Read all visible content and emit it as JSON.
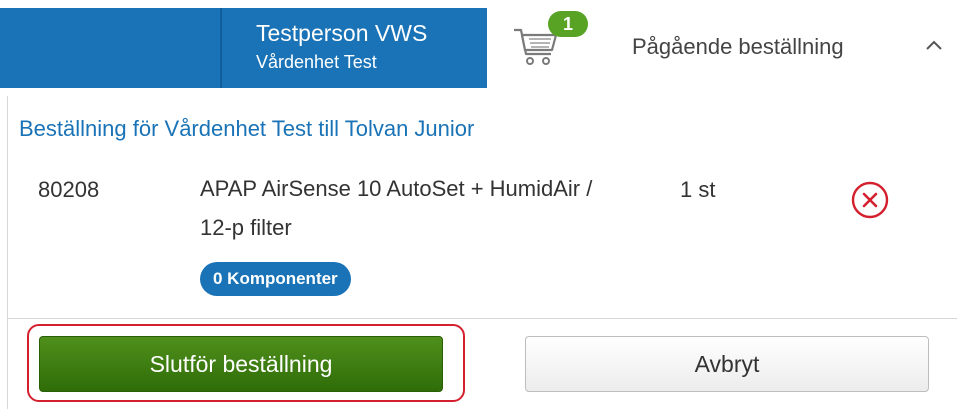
{
  "header": {
    "user_name": "Testperson VWS",
    "user_unit": "Vårdenhet Test",
    "cart_count": "1",
    "cart_title": "Pågående beställning",
    "cart_icon": "cart-icon",
    "collapse_icon": "chevron-up-icon"
  },
  "order": {
    "heading": "Beställning för Vårdenhet Test till Tolvan Junior",
    "items": [
      {
        "article_number": "80208",
        "description": "APAP AirSense 10 AutoSet + HumidAir / 12-p filter",
        "quantity": "1 st",
        "components_label": "0 Komponenter",
        "remove_icon": "remove-circle-x-icon"
      }
    ]
  },
  "actions": {
    "finish_label": "Slutför beställning",
    "cancel_label": "Avbryt"
  },
  "colors": {
    "brand_blue": "#1a73b6",
    "success_green": "#3d7d11",
    "badge_green": "#58a324",
    "danger_red": "#d4202e"
  }
}
